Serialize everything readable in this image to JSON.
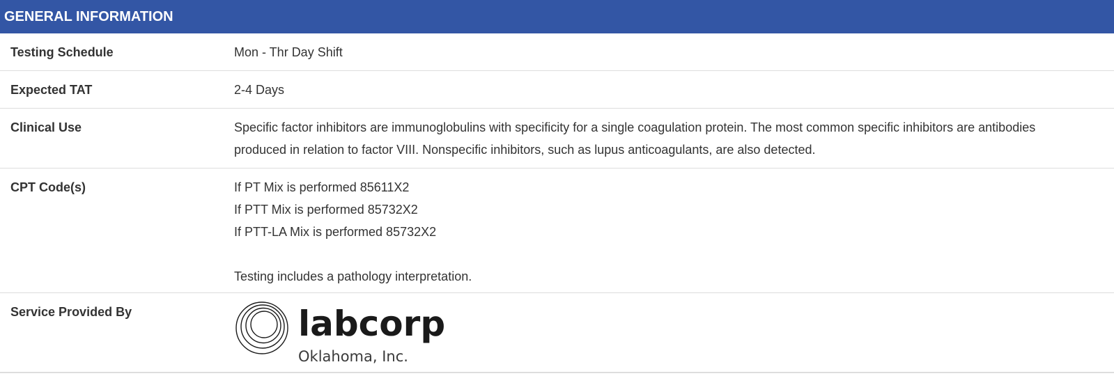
{
  "header": {
    "title": "GENERAL INFORMATION"
  },
  "rows": {
    "schedule": {
      "label": "Testing Schedule",
      "value": "Mon - Thr Day Shift"
    },
    "tat": {
      "label": "Expected TAT",
      "value": "2-4 Days"
    },
    "clinical": {
      "label": "Clinical Use",
      "value": "Specific factor inhibitors are immunoglobulins with specificity for a single coagulation protein. The most common specific inhibitors are antibodies produced in relation to factor VIII. Nonspecific inhibitors, such as lupus anticoagulants, are also detected."
    },
    "cpt": {
      "label": "CPT Code(s)",
      "lines": [
        "If PT Mix is performed 85611X2",
        "If PTT Mix is performed 85732X2",
        "If PTT-LA Mix is performed 85732X2"
      ],
      "note": "Testing includes a pathology interpretation."
    },
    "service": {
      "label": "Service Provided By",
      "logo": {
        "name": "labcorp",
        "subtitle": "Oklahoma, Inc.",
        "icon": "concentric-circles-logo-icon"
      }
    }
  },
  "colors": {
    "header_bg": "#3356a5",
    "header_text": "#ffffff",
    "text": "#333333",
    "divider": "#dddddd"
  }
}
